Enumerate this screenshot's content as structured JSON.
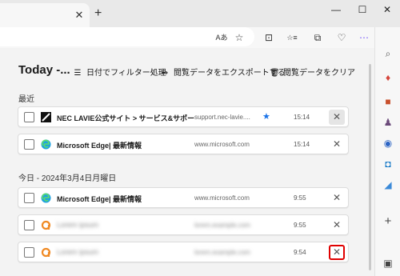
{
  "window": {
    "minimize": "—",
    "maximize": "☐",
    "close": "✕"
  },
  "tab": {
    "close": "✕",
    "new_tab": "+"
  },
  "toolbar_icons": {
    "read_aloud": "Aあ",
    "favorite": "☆",
    "split": "⊡",
    "favorites": "☆≡",
    "collections": "⧉",
    "health": "♡",
    "copilot": "◆"
  },
  "page": {
    "title": "Today -...",
    "filter_label": "日付でフィルター処理",
    "export_label": "閲覧データをエクスポートする",
    "clear_label": "閲覧データをクリア",
    "filter_icon": "filter-icon",
    "export_icon": "export-icon",
    "clear_icon": "trash-icon"
  },
  "sections": [
    {
      "label": "最近"
    },
    {
      "label": "今日 - 2024年3月4日月曜日"
    }
  ],
  "rows": [
    {
      "title": "NEC LAVIE公式サイト > サービス&サポート > ホ...",
      "url": "support.nec-lavie....",
      "time": "15:14",
      "starred": true,
      "icon": "nec-icon",
      "delete": "✕"
    },
    {
      "title": "Microsoft Edge| 最新情報",
      "url": "www.microsoft.com",
      "time": "15:14",
      "starred": false,
      "icon": "edge-icon",
      "delete": "✕"
    },
    {
      "title": "Microsoft Edge| 最新情報",
      "url": "www.microsoft.com",
      "time": "9:55",
      "starred": false,
      "icon": "edge-icon",
      "delete": "✕"
    },
    {
      "title": "Lorem ipsum",
      "url": "lorem.example.com",
      "time": "9:55",
      "starred": false,
      "icon": "orange-icon",
      "delete": "✕"
    },
    {
      "title": "Lorem ipsum",
      "url": "lorem.example.com",
      "time": "9:54",
      "starred": false,
      "icon": "orange-icon",
      "delete": "✕"
    }
  ],
  "colors": {
    "accent": "#1a73e8",
    "highlight": "#e00000",
    "orange": "#f08a24"
  }
}
